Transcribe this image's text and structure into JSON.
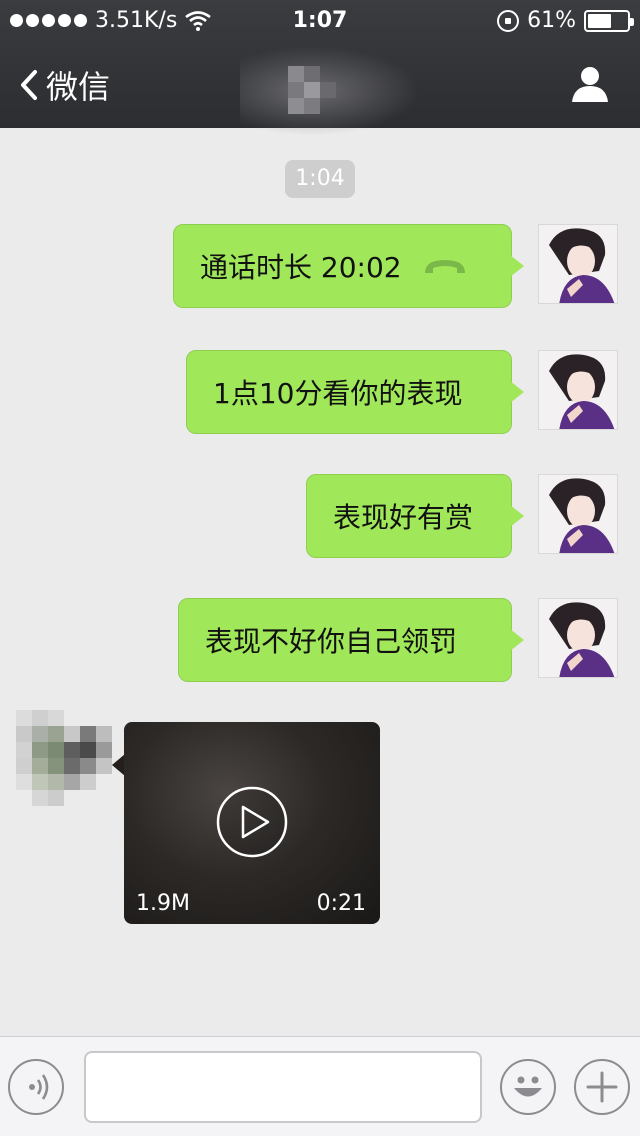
{
  "status_bar": {
    "network_speed": "3.51K/s",
    "time": "1:07",
    "battery_percent": "61%",
    "battery_level": 0.61
  },
  "nav": {
    "back_label": "微信",
    "contact_icon": "person-icon"
  },
  "chat": {
    "timestamp": "1:04",
    "messages": [
      {
        "text": "通话时长 20:02",
        "icon": "phone-hangup-icon"
      },
      {
        "text": "1点10分看你的表现"
      },
      {
        "text": "表现好有赏"
      },
      {
        "text": "表现不好你自己领罚"
      }
    ],
    "video": {
      "size": "1.9M",
      "duration": "0:21",
      "icon": "play-icon"
    }
  },
  "input_bar": {
    "voice_icon": "voice-icon",
    "emoji_icon": "emoji-icon",
    "add_icon": "plus-icon"
  },
  "colors": {
    "sent_bubble": "#a0e75a",
    "nav_bg": "#333437",
    "chat_bg": "#ebebeb"
  }
}
